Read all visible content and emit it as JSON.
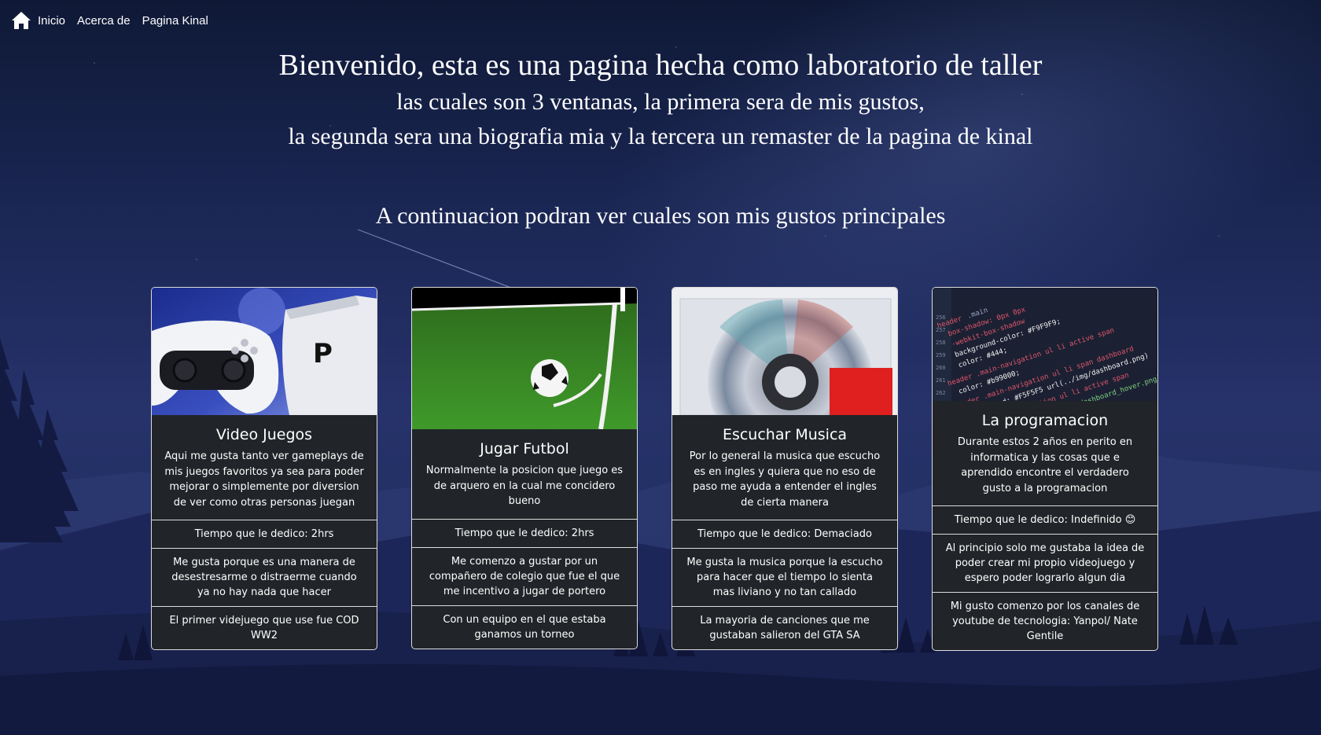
{
  "nav": {
    "home_icon": "home-icon",
    "links": [
      "Inicio",
      "Acerca de",
      "Pagina Kinal"
    ]
  },
  "hero": {
    "line1": "Bienvenido, esta es una pagina hecha como laboratorio de taller",
    "line2": "las cuales son 3 ventanas, la primera sera de mis gustos,",
    "line3": "la segunda sera una biografia mia y la tercera un remaster de la pagina de kinal"
  },
  "subtitle": "A continuacion podran ver cuales son mis gustos principales",
  "colors": {
    "card_bg": "#212529",
    "card_border": "#dcdcdc",
    "page_bg": "#1f2a5c"
  },
  "cards": [
    {
      "image": "playstation-controller-image",
      "title": "Video Juegos",
      "text": "Aqui me gusta tanto ver gameplays de mis juegos favoritos ya sea para poder mejorar o simplemente por diversion de ver como otras personas juegan",
      "items": [
        "Tiempo que le dedico: 2hrs",
        "Me gusta porque es una manera de desestresarme o distraerme cuando ya no hay nada que hacer",
        "El primer videjuego que use fue COD WW2"
      ]
    },
    {
      "image": "soccer-field-image",
      "title": "Jugar Futbol",
      "text": "Normalmente la posicion que juego es de arquero en la cual me concidero bueno",
      "items": [
        "Tiempo que le dedico: 2hrs",
        "Me comenzo a gustar por un compañero de colegio que fue el que me incentivo a jugar de portero",
        "Con un equipo en el que estaba ganamos un torneo"
      ]
    },
    {
      "image": "cd-album-image",
      "title": "Escuchar Musica",
      "text": "Por lo general la musica que escucho es en ingles y quiera que no eso de paso me ayuda a entender el ingles de cierta manera",
      "items": [
        "Tiempo que le dedico: Demaciado",
        "Me gusta la musica porque la escucho para hacer que el tiempo lo sienta mas liviano y no tan callado",
        "La mayoria de canciones que me gustaban salieron del GTA SA"
      ]
    },
    {
      "image": "code-editor-image",
      "title": "La programacion",
      "text": "Durante estos 2 años en perito en informatica y las cosas que e aprendido encontre el verdadero gusto a la programacion",
      "items": [
        "Tiempo que le dedico: Indefinido 😊",
        "Al principio solo me gustaba la idea de poder crear mi propio videojuego y espero poder lograrlo algun dia",
        "Mi gusto comenzo por los canales de youtube de tecnologia: Yanpol/ Nate Gentile"
      ]
    }
  ]
}
